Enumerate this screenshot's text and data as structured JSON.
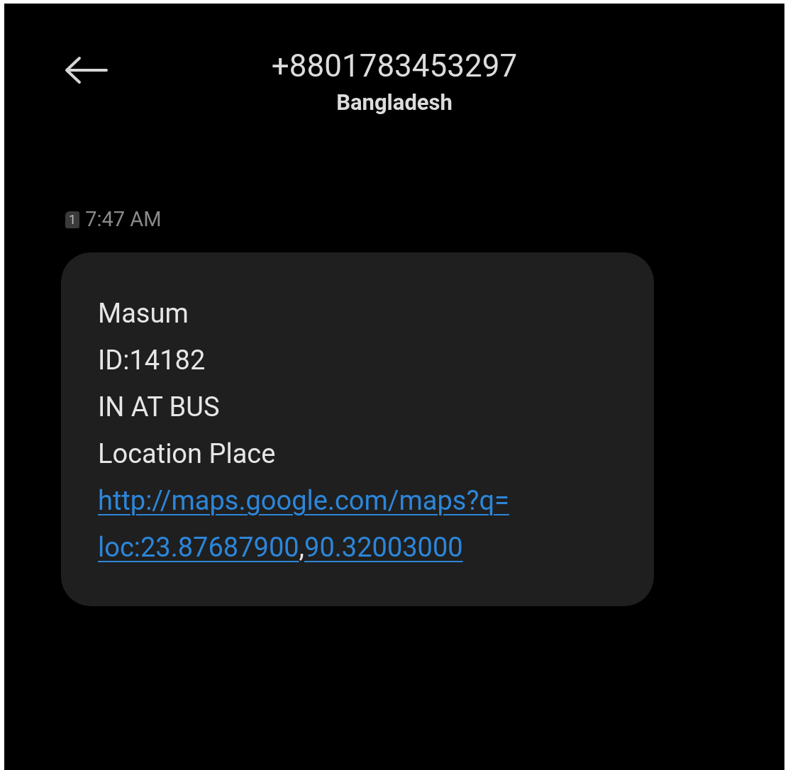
{
  "header": {
    "title": "+8801783453297",
    "subtitle": "Bangladesh"
  },
  "timestamp": {
    "sim": "1",
    "time": "7:47 AM"
  },
  "message": {
    "lines": [
      {
        "parts": [
          {
            "text": "Masum",
            "link": false
          }
        ]
      },
      {
        "parts": [
          {
            "text": "ID:14182",
            "link": false
          }
        ]
      },
      {
        "parts": [
          {
            "text": "IN AT BUS",
            "link": false
          }
        ]
      },
      {
        "parts": [
          {
            "text": "Location Place",
            "link": false
          }
        ]
      },
      {
        "parts": [
          {
            "text": "http://maps.google.com/maps?q=",
            "link": true
          }
        ]
      },
      {
        "parts": [
          {
            "text": "loc:23.87687900",
            "link": true
          },
          {
            "text": ",",
            "link": false
          },
          {
            "text": "90.32003000",
            "link": true
          }
        ]
      }
    ]
  }
}
